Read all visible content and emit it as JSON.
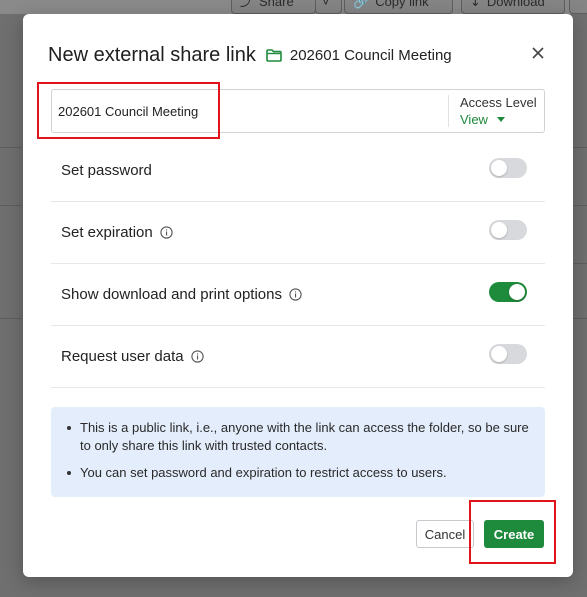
{
  "background_toolbar": {
    "share_label": "Share",
    "copy_link_label": "Copy link",
    "download_label": "Download"
  },
  "dialog": {
    "title": "New external share link",
    "folder_icon": "folder-icon",
    "folder_name": "202601 Council Meeting",
    "close_icon": "close-icon"
  },
  "link_name_field": {
    "value": "202601 Council Meeting"
  },
  "access_level": {
    "label": "Access Level",
    "value": "View"
  },
  "options": [
    {
      "label": "Set password",
      "info_icon": false,
      "enabled": false
    },
    {
      "label": "Set expiration",
      "info_icon": true,
      "enabled": false
    },
    {
      "label": "Show download and print options",
      "info_icon": true,
      "enabled": true
    },
    {
      "label": "Request user data",
      "info_icon": true,
      "enabled": false
    }
  ],
  "notice": {
    "items": [
      "This is a public link, i.e., anyone with the link can access the folder, so be sure to only share this link with trusted contacts.",
      "You can set password and expiration to restrict access to users."
    ]
  },
  "footer": {
    "cancel_label": "Cancel",
    "create_label": "Create"
  },
  "colors": {
    "accent_green": "#1e8a3c",
    "notice_bg": "#e3edfb",
    "highlight_red": "#e0141a"
  }
}
